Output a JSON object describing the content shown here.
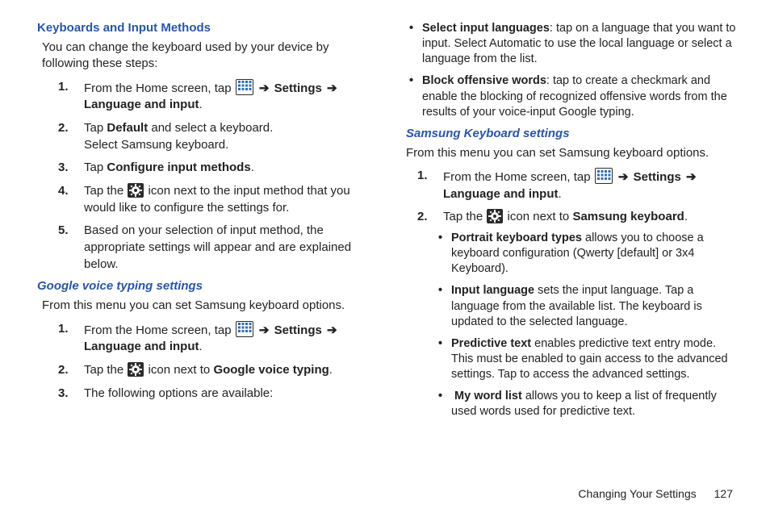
{
  "left": {
    "h_keyboards": "Keyboards and Input Methods",
    "lead1": "You can change the keyboard used by your device by following these steps:",
    "steps1": {
      "s1": {
        "num": "1.",
        "pre": "From the Home screen, tap",
        "post_settings": "Settings",
        "post_langinput": "Language and input"
      },
      "s2": {
        "num": "2.",
        "line1a": "Tap ",
        "line1b": "Default",
        "line1c": " and select a keyboard.",
        "line2": "Select Samsung keyboard."
      },
      "s3": {
        "num": "3.",
        "a": "Tap ",
        "b": "Configure input methods",
        "c": "."
      },
      "s4": {
        "num": "4.",
        "pre": "Tap the ",
        "post": " icon next to the input method that you would like to configure the settings for."
      },
      "s5": {
        "num": "5.",
        "text": "Based on your selection of input method, the appropriate settings will appear and are explained below."
      }
    },
    "h_gvt": "Google voice typing settings",
    "lead2": "From this menu you can set Samsung keyboard options.",
    "steps2": {
      "s1": {
        "num": "1.",
        "pre": "From the Home screen, tap",
        "post_settings": "Settings",
        "post_langinput": "Language and input"
      },
      "s2": {
        "num": "2.",
        "pre": "Tap the ",
        "mid": " icon next to ",
        "bold": "Google voice typing",
        "end": "."
      },
      "s3": {
        "num": "3.",
        "text": "The following options are available:"
      }
    }
  },
  "right": {
    "bul_top": {
      "b1": {
        "bold": "Select input languages",
        "text": ": tap on a language that you want to input. Select Automatic to use the local language or select a language from the list."
      },
      "b2": {
        "bold": "Block offensive words",
        "text": ": tap to create a checkmark and enable the blocking of recognized offensive words from the results of your voice-input Google typing."
      }
    },
    "h_sk": "Samsung Keyboard settings",
    "lead3": "From this menu you can set Samsung keyboard options.",
    "steps3": {
      "s1": {
        "num": "1.",
        "pre": "From the Home screen, tap",
        "post_settings": "Settings",
        "post_langinput": "Language and input"
      },
      "s2": {
        "num": "2.",
        "pre": "Tap the ",
        "mid": " icon next to ",
        "bold": "Samsung keyboard",
        "end": "."
      }
    },
    "bul_sk": {
      "b1": {
        "bold": "Portrait keyboard types",
        "text": " allows you to choose a keyboard configuration (Qwerty [default] or 3x4 Keyboard)."
      },
      "b2": {
        "bold": "Input language",
        "text": " sets the input language. Tap a language from the available list. The keyboard is updated to the selected language."
      },
      "b3": {
        "bold": "Predictive text",
        "text": " enables predictive text entry mode. This must be enabled to gain access to the advanced settings. Tap to access the advanced settings."
      },
      "b4": {
        "bold": "My word list",
        "text": " allows you to keep a list of frequently used words used for predictive text."
      }
    }
  },
  "footer": {
    "title": "Changing Your Settings",
    "page": "127"
  },
  "glyphs": {
    "arrow": "➔"
  }
}
